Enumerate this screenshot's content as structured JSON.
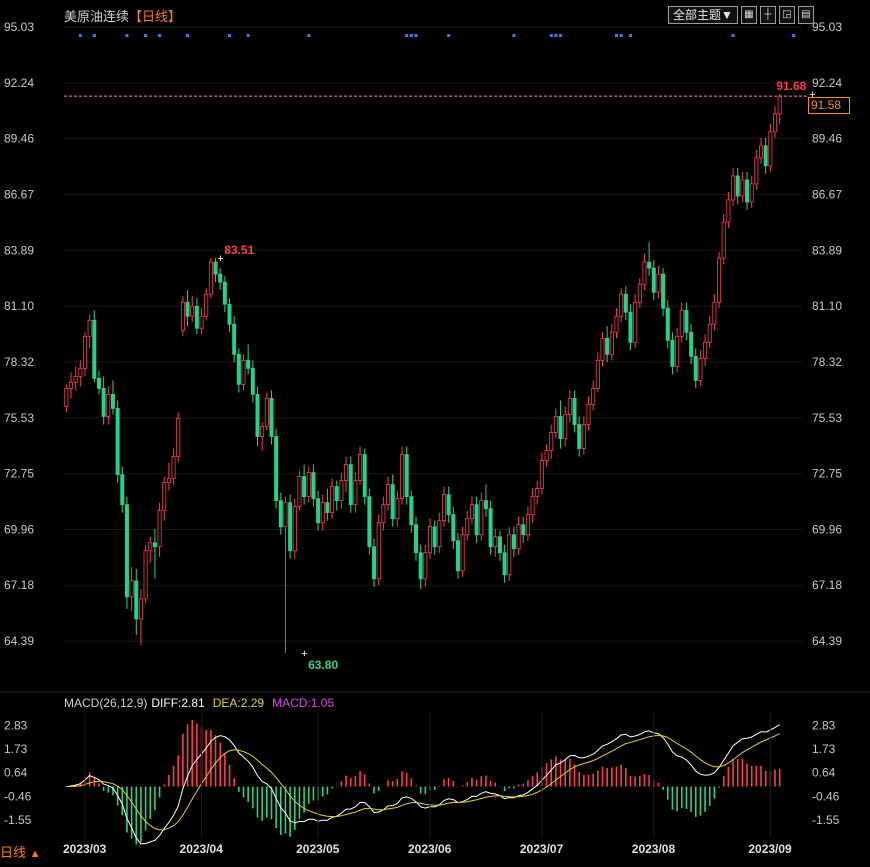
{
  "header": {
    "symbol_name": "美原油连续",
    "period_label": "【日线】",
    "theme_button": "全部主题▼",
    "toolbar_icons": [
      "grid-icon",
      "crosshair-icon",
      "chart-expand-icon",
      "chart-layout-icon"
    ]
  },
  "colors": {
    "up": "#ff3b4e",
    "down": "#22d38a",
    "background": "#000000",
    "axis_text": "#c8c8c8",
    "last_price_line": "#ff9d2e",
    "diff_line": "#ffffff",
    "dea_line": "#e3d21a",
    "macd_label": "#e040e0",
    "event_dot": "#2f7fff",
    "high_label": "#ff3b4e",
    "low_label": "#22d38a"
  },
  "chart_data": [
    {
      "type": "candlestick",
      "title": "美原油连续【日线】",
      "y_ticks": [
        "95.03",
        "92.24",
        "89.46",
        "86.67",
        "83.89",
        "81.10",
        "78.32",
        "75.53",
        "72.75",
        "69.96",
        "67.18",
        "64.39"
      ],
      "ylim": [
        63.3,
        95.03
      ],
      "x_ticks": [
        "2023/03",
        "2023/04",
        "2023/05",
        "2023/06",
        "2023/07",
        "2023/08",
        "2023/09"
      ],
      "x_tick_index": [
        4,
        29,
        54,
        78,
        102,
        126,
        151
      ],
      "annotations": [
        {
          "label": "83.51",
          "index": 33,
          "value": 83.51,
          "kind": "high"
        },
        {
          "label": "63.80",
          "index": 51,
          "value": 63.8,
          "kind": "low"
        },
        {
          "label": "91.68",
          "index": 160,
          "value": 91.68,
          "kind": "high"
        }
      ],
      "last_price": 91.58,
      "event_markers_index": [
        3,
        6,
        13,
        17,
        20,
        26,
        35,
        39,
        52,
        73,
        74,
        75,
        82,
        96,
        104,
        105,
        106,
        118,
        119,
        121,
        143,
        156
      ],
      "ohlc": [
        [
          76.1,
          77.2,
          75.8,
          77.0
        ],
        [
          77.0,
          77.8,
          76.5,
          77.3
        ],
        [
          77.3,
          78.1,
          76.9,
          77.6
        ],
        [
          77.6,
          78.4,
          77.1,
          78.0
        ],
        [
          78.0,
          79.8,
          77.6,
          79.6
        ],
        [
          79.6,
          80.7,
          79.0,
          80.4
        ],
        [
          80.4,
          80.9,
          77.3,
          77.5
        ],
        [
          77.5,
          77.9,
          76.7,
          77.0
        ],
        [
          77.0,
          77.6,
          75.2,
          75.6
        ],
        [
          75.6,
          77.1,
          75.2,
          76.7
        ],
        [
          76.7,
          77.4,
          75.7,
          76.0
        ],
        [
          76.0,
          76.4,
          72.3,
          72.7
        ],
        [
          72.7,
          73.1,
          70.8,
          71.2
        ],
        [
          71.2,
          71.6,
          66.0,
          66.6
        ],
        [
          66.6,
          68.1,
          65.9,
          67.4
        ],
        [
          67.4,
          68.0,
          64.7,
          65.5
        ],
        [
          65.5,
          67.0,
          64.2,
          66.5
        ],
        [
          66.5,
          69.2,
          66.3,
          68.9
        ],
        [
          68.9,
          69.6,
          68.3,
          69.3
        ],
        [
          69.3,
          70.0,
          67.5,
          69.1
        ],
        [
          69.1,
          71.3,
          68.6,
          70.9
        ],
        [
          70.9,
          72.6,
          70.4,
          72.3
        ],
        [
          72.3,
          73.3,
          71.9,
          72.5
        ],
        [
          72.5,
          74.0,
          72.2,
          73.6
        ],
        [
          73.6,
          75.8,
          73.3,
          75.5
        ],
        [
          79.9,
          81.6,
          79.6,
          81.3
        ],
        [
          81.3,
          81.9,
          80.1,
          80.6
        ],
        [
          80.6,
          81.6,
          80.3,
          81.1
        ],
        [
          81.1,
          81.5,
          79.7,
          80.0
        ],
        [
          80.0,
          81.0,
          79.7,
          80.6
        ],
        [
          80.6,
          82.0,
          80.4,
          81.7
        ],
        [
          81.7,
          83.51,
          81.5,
          83.3
        ],
        [
          83.3,
          83.5,
          82.3,
          82.7
        ],
        [
          82.7,
          83.0,
          81.9,
          82.3
        ],
        [
          82.3,
          82.6,
          80.8,
          81.2
        ],
        [
          81.2,
          81.5,
          79.8,
          80.2
        ],
        [
          80.2,
          80.6,
          78.3,
          78.7
        ],
        [
          78.7,
          79.0,
          76.8,
          77.2
        ],
        [
          77.2,
          78.7,
          76.9,
          78.4
        ],
        [
          78.4,
          79.2,
          77.7,
          78.0
        ],
        [
          78.0,
          78.4,
          76.3,
          76.7
        ],
        [
          76.7,
          77.1,
          74.1,
          74.6
        ],
        [
          74.6,
          75.3,
          73.9,
          75.1
        ],
        [
          75.1,
          76.8,
          74.9,
          76.5
        ],
        [
          76.5,
          76.9,
          74.2,
          74.6
        ],
        [
          74.6,
          75.0,
          71.0,
          71.4
        ],
        [
          71.4,
          71.8,
          69.7,
          70.1
        ],
        [
          70.1,
          71.6,
          63.8,
          71.3
        ],
        [
          71.3,
          71.7,
          68.5,
          68.9
        ],
        [
          68.9,
          71.5,
          68.5,
          71.1
        ],
        [
          71.1,
          72.9,
          70.9,
          72.6
        ],
        [
          72.6,
          73.2,
          71.2,
          71.6
        ],
        [
          71.6,
          73.1,
          71.3,
          72.8
        ],
        [
          72.8,
          73.2,
          71.1,
          71.5
        ],
        [
          71.5,
          71.9,
          69.9,
          70.3
        ],
        [
          70.3,
          71.7,
          69.9,
          71.3
        ],
        [
          71.3,
          72.0,
          70.4,
          70.8
        ],
        [
          70.8,
          72.5,
          70.5,
          72.1
        ],
        [
          72.1,
          72.4,
          70.9,
          71.4
        ],
        [
          71.4,
          72.8,
          71.0,
          72.4
        ],
        [
          72.4,
          73.6,
          71.8,
          73.2
        ],
        [
          73.2,
          73.6,
          70.8,
          71.2
        ],
        [
          71.2,
          72.8,
          70.8,
          72.4
        ],
        [
          72.4,
          74.1,
          72.2,
          73.7
        ],
        [
          73.7,
          74.0,
          71.2,
          71.6
        ],
        [
          71.6,
          72.0,
          68.7,
          69.1
        ],
        [
          69.1,
          69.5,
          67.1,
          67.5
        ],
        [
          67.5,
          70.7,
          67.2,
          70.3
        ],
        [
          70.3,
          71.6,
          69.9,
          71.2
        ],
        [
          71.2,
          72.6,
          70.9,
          72.2
        ],
        [
          72.2,
          72.7,
          70.1,
          70.5
        ],
        [
          70.5,
          71.9,
          70.1,
          71.5
        ],
        [
          71.5,
          74.1,
          71.2,
          73.7
        ],
        [
          73.7,
          74.1,
          71.2,
          71.6
        ],
        [
          71.6,
          71.9,
          69.8,
          70.2
        ],
        [
          70.2,
          70.6,
          68.4,
          68.8
        ],
        [
          68.8,
          69.2,
          67.0,
          67.5
        ],
        [
          67.5,
          69.2,
          67.1,
          68.8
        ],
        [
          68.8,
          70.5,
          68.5,
          70.1
        ],
        [
          70.1,
          70.4,
          68.7,
          69.1
        ],
        [
          69.1,
          70.8,
          68.8,
          70.4
        ],
        [
          70.4,
          72.1,
          70.1,
          71.7
        ],
        [
          71.7,
          72.1,
          70.3,
          70.7
        ],
        [
          70.7,
          71.1,
          69.0,
          69.4
        ],
        [
          69.4,
          69.8,
          67.5,
          67.9
        ],
        [
          67.9,
          70.1,
          67.6,
          69.7
        ],
        [
          69.7,
          70.9,
          69.4,
          70.5
        ],
        [
          70.5,
          71.6,
          70.2,
          71.2
        ],
        [
          71.2,
          71.6,
          69.3,
          69.7
        ],
        [
          69.7,
          71.8,
          69.4,
          71.4
        ],
        [
          71.4,
          72.2,
          70.6,
          71.0
        ],
        [
          71.0,
          71.4,
          68.7,
          69.1
        ],
        [
          69.1,
          70.0,
          68.6,
          69.6
        ],
        [
          69.6,
          69.9,
          68.4,
          68.8
        ],
        [
          68.8,
          69.2,
          67.3,
          67.7
        ],
        [
          67.7,
          70.1,
          67.4,
          69.7
        ],
        [
          69.7,
          70.1,
          68.6,
          69.0
        ],
        [
          69.0,
          70.6,
          68.7,
          70.2
        ],
        [
          70.2,
          70.6,
          69.3,
          69.7
        ],
        [
          69.7,
          71.1,
          69.4,
          70.7
        ],
        [
          70.7,
          72.0,
          70.3,
          71.6
        ],
        [
          71.6,
          72.4,
          71.2,
          72.0
        ],
        [
          72.0,
          73.8,
          71.7,
          73.4
        ],
        [
          73.4,
          74.2,
          73.1,
          73.9
        ],
        [
          73.9,
          75.2,
          73.5,
          74.8
        ],
        [
          74.8,
          76.0,
          74.5,
          75.6
        ],
        [
          75.6,
          76.4,
          74.0,
          74.5
        ],
        [
          74.5,
          76.1,
          74.1,
          75.7
        ],
        [
          75.7,
          76.9,
          75.3,
          76.5
        ],
        [
          76.5,
          76.9,
          74.8,
          75.2
        ],
        [
          75.2,
          75.6,
          73.6,
          74.0
        ],
        [
          74.0,
          75.6,
          73.7,
          75.2
        ],
        [
          75.2,
          76.6,
          74.9,
          76.2
        ],
        [
          76.2,
          77.4,
          75.9,
          77.0
        ],
        [
          77.0,
          78.8,
          76.8,
          78.4
        ],
        [
          78.4,
          79.8,
          78.1,
          79.5
        ],
        [
          79.5,
          80.1,
          78.3,
          78.7
        ],
        [
          78.7,
          80.2,
          78.4,
          79.8
        ],
        [
          79.8,
          81.0,
          79.5,
          80.6
        ],
        [
          80.6,
          82.0,
          80.3,
          81.7
        ],
        [
          81.7,
          82.1,
          80.4,
          80.8
        ],
        [
          80.8,
          81.2,
          78.9,
          79.3
        ],
        [
          79.3,
          81.7,
          79.0,
          81.3
        ],
        [
          81.3,
          82.5,
          81.0,
          82.2
        ],
        [
          82.2,
          83.7,
          81.9,
          83.3
        ],
        [
          83.3,
          84.3,
          82.6,
          83.0
        ],
        [
          83.0,
          83.4,
          81.4,
          81.8
        ],
        [
          81.8,
          83.1,
          81.5,
          82.7
        ],
        [
          82.7,
          83.0,
          80.6,
          81.0
        ],
        [
          81.0,
          81.4,
          79.0,
          79.4
        ],
        [
          79.4,
          79.8,
          77.7,
          78.1
        ],
        [
          78.1,
          80.0,
          77.8,
          79.6
        ],
        [
          79.6,
          81.3,
          79.3,
          80.9
        ],
        [
          80.9,
          81.3,
          79.4,
          79.8
        ],
        [
          79.8,
          80.2,
          78.2,
          78.6
        ],
        [
          78.6,
          79.0,
          77.0,
          77.4
        ],
        [
          77.4,
          78.9,
          77.1,
          78.5
        ],
        [
          78.5,
          79.7,
          78.1,
          79.3
        ],
        [
          79.3,
          80.6,
          79.0,
          80.2
        ],
        [
          80.2,
          81.7,
          79.9,
          81.3
        ],
        [
          81.3,
          83.8,
          81.0,
          83.5
        ],
        [
          83.5,
          85.7,
          83.2,
          85.3
        ],
        [
          85.3,
          86.8,
          85.0,
          86.4
        ],
        [
          86.4,
          88.0,
          86.1,
          87.6
        ],
        [
          87.6,
          88.0,
          86.2,
          86.6
        ],
        [
          86.6,
          87.8,
          86.3,
          87.4
        ],
        [
          87.4,
          87.8,
          85.9,
          86.3
        ],
        [
          86.3,
          87.6,
          86.0,
          87.2
        ],
        [
          87.2,
          88.9,
          86.9,
          88.5
        ],
        [
          88.5,
          89.5,
          88.2,
          89.1
        ],
        [
          89.1,
          89.5,
          87.7,
          88.1
        ],
        [
          88.1,
          90.2,
          87.8,
          89.8
        ],
        [
          89.8,
          91.1,
          89.5,
          90.7
        ],
        [
          90.7,
          91.68,
          90.2,
          91.58
        ]
      ]
    },
    {
      "type": "macd",
      "params_label": "MACD(26,12,9)",
      "diff_label": "DIFF:2.81",
      "dea_label": "DEA:2.29",
      "macd_label": "MACD:1.05",
      "y_ticks": [
        "2.83",
        "1.73",
        "0.64",
        "-0.46",
        "-1.55"
      ],
      "ylim": [
        -2.1,
        3.4
      ]
    }
  ],
  "bottom": {
    "period_tab": "日线",
    "period_arrow": "▲"
  }
}
